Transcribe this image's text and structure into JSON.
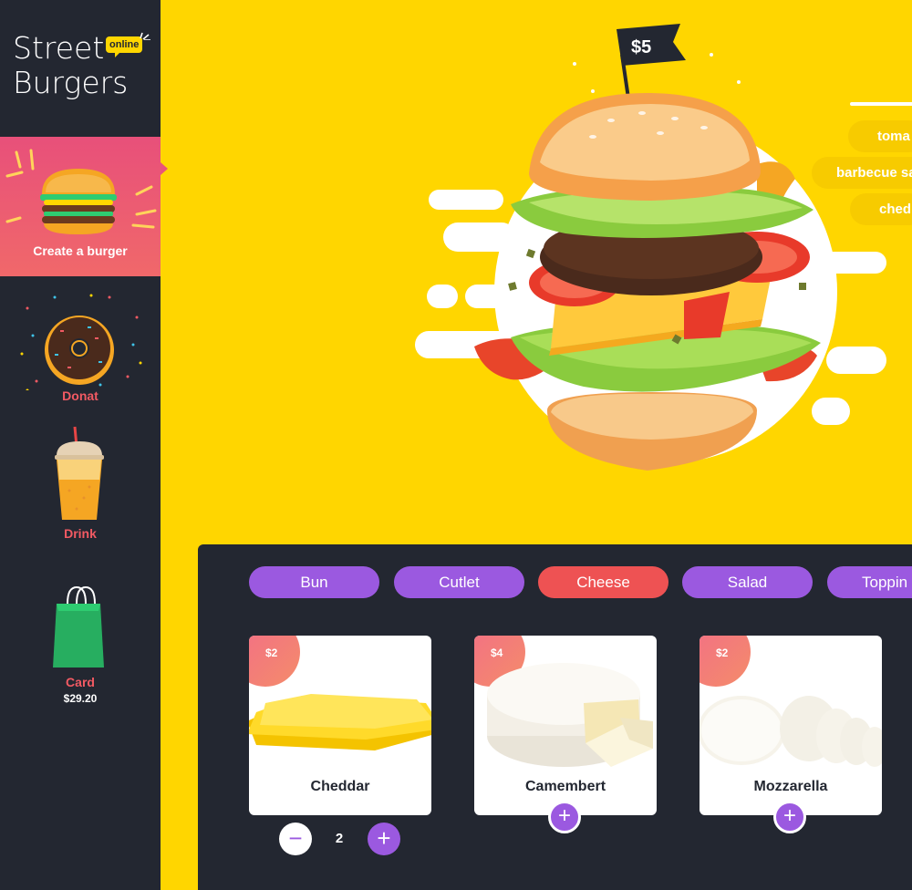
{
  "app": {
    "logo_line1": "Street",
    "logo_line2": "Burgers",
    "logo_badge": "online"
  },
  "sidebar": {
    "items": [
      {
        "label": "Create a burger",
        "icon": "burger-icon",
        "active": true
      },
      {
        "label": "Donat",
        "icon": "donut-icon",
        "active": false
      },
      {
        "label": "Drink",
        "icon": "drink-cup-icon",
        "active": false
      },
      {
        "label": "Card",
        "icon": "shopping-bag-icon",
        "active": false,
        "total": "$29.20"
      }
    ]
  },
  "hero": {
    "price_flag": "$5",
    "ingredients": [
      "toma",
      "barbecue sa",
      "ched"
    ]
  },
  "builder": {
    "tabs": [
      {
        "label": "Bun",
        "active": false
      },
      {
        "label": "Cutlet",
        "active": false
      },
      {
        "label": "Cheese",
        "active": true
      },
      {
        "label": "Salad",
        "active": false
      },
      {
        "label": "Toppin",
        "active": false
      }
    ],
    "products": [
      {
        "name": "Cheddar",
        "price": "$2",
        "quantity": "2"
      },
      {
        "name": "Camembert",
        "price": "$4"
      },
      {
        "name": "Mozzarella",
        "price": "$2"
      }
    ],
    "minus_symbol": "−",
    "plus_symbol": "+"
  },
  "colors": {
    "background": "#FFD600",
    "sidebar": "#232731",
    "accent_purple": "#9B59E0",
    "accent_red": "#EE5253",
    "active_nav": "#E8507A"
  }
}
